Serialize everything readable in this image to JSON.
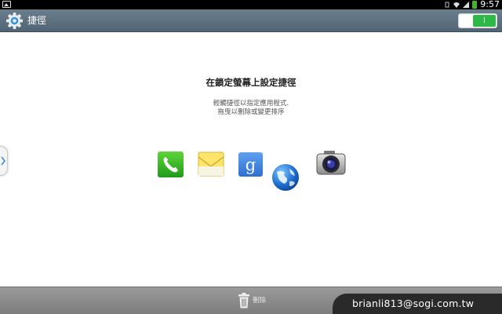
{
  "status_bar": {
    "time": "9:57",
    "icons": [
      "gallery-icon",
      "vibrate-icon",
      "wifi-icon",
      "signal-icon",
      "battery-icon"
    ]
  },
  "action_bar": {
    "title": "捷徑",
    "icon": "settings-gear-icon",
    "toggle": {
      "state": "on",
      "label": "I"
    }
  },
  "main": {
    "heading": "在鎖定螢幕上設定捷徑",
    "description_lines": [
      "輕觸捷徑以指定應用程式.",
      "拖曳以刪除或變更排序"
    ],
    "shortcuts": [
      {
        "name": "phone-app-icon"
      },
      {
        "name": "email-app-icon"
      },
      {
        "name": "google-search-app-icon"
      },
      {
        "name": "internet-browser-app-icon"
      },
      {
        "name": "camera-app-icon"
      }
    ]
  },
  "bottom_bar": {
    "delete_label": "刪除",
    "watermark": "brianli813@sogi.com.tw"
  },
  "colors": {
    "action_bar": "#5d7181",
    "toggle_on": "#2eb847",
    "bottom_bar": "#8c8c8c"
  }
}
